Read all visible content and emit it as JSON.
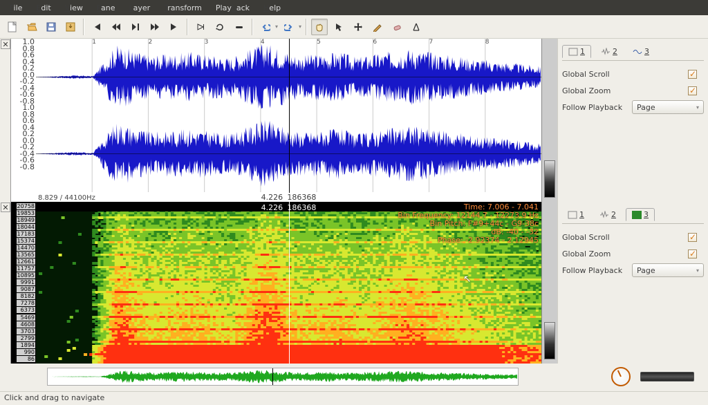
{
  "menu": {
    "file": "File",
    "edit": "Edit",
    "view": "View",
    "pane": "Pane",
    "layer": "Layer",
    "transform": "Transform",
    "playback": "Playback",
    "help": "Help"
  },
  "statusbar": "Click and drag to navigate",
  "wave": {
    "info_left": "8.829 / 44100Hz",
    "center_time": "4.226",
    "center_frame": "186368",
    "scale": [
      "1.0",
      "0.8",
      "0.6",
      "0.4",
      "0.2",
      "0.0",
      "-0.2",
      "-0.4",
      "-0.6",
      "-0.8",
      "1.0",
      "0.8",
      "0.6",
      "0.4",
      "0.2",
      "0.0",
      "-0.2",
      "-0.4",
      "-0.6",
      "-0.8"
    ],
    "time_ticks": [
      "1",
      "2",
      "3",
      "4",
      "5",
      "6",
      "7",
      "8"
    ]
  },
  "spec": {
    "center_time": "4.226",
    "center_frame": "186368",
    "info": {
      "time": "Time: 7.006 - 7.041",
      "freq": "Bin Frequency: 12144.7 - 12273.9 Hz",
      "pitch": "Bin Pitch: F#9+44c - G9-38c",
      "db": "dB: -40 - -32",
      "phase": "Phase: -2.92374 - 2.12945"
    },
    "freq_labels": [
      "20758",
      "19853",
      "18949",
      "18044",
      "17183",
      "15374",
      "14470",
      "13565",
      "12661",
      "11757",
      "10895",
      "9991",
      "9087",
      "8182",
      "7278",
      "6373",
      "5469",
      "4608",
      "3703",
      "2799",
      "1894",
      "990",
      "86"
    ]
  },
  "panel": {
    "tab1": "1",
    "tab2": "2",
    "tab3": "3",
    "global_scroll": "Global Scroll",
    "global_zoom": "Global Zoom",
    "follow_pb": "Follow Playback",
    "follow_val": "Page"
  },
  "chart_data": [
    {
      "type": "waveform",
      "channels": 2,
      "sample_rate_hz": 44100,
      "duration_s": 8.829,
      "time_s": [
        0.0,
        0.7,
        1.0,
        1.4,
        2.0,
        2.7,
        3.4,
        4.0,
        4.6,
        5.3,
        5.6,
        6.5,
        7.5,
        8.8
      ],
      "peak_amplitude": [
        0.0,
        0.05,
        0.03,
        0.9,
        0.6,
        0.7,
        0.55,
        0.95,
        0.6,
        0.7,
        0.55,
        0.8,
        0.55,
        0.3
      ],
      "ylim": [
        -1.0,
        1.0
      ],
      "color": "#1818c8",
      "playhead_s": 4.226,
      "playhead_frame": 186368
    },
    {
      "type": "spectrogram",
      "x_s": [
        0.0,
        8.829
      ],
      "y_hz": [
        86,
        20758
      ],
      "colormap": "green-yellow-red (dB)",
      "db_range": [
        -80,
        0
      ],
      "cursor": {
        "time_s": [
          7.006,
          7.041
        ],
        "freq_hz": [
          12144.7,
          12273.9
        ],
        "db": [
          -40,
          -32
        ],
        "pitch": "F#9+44c – G9-38c",
        "phase": [
          -2.92374,
          2.12945
        ]
      }
    }
  ]
}
